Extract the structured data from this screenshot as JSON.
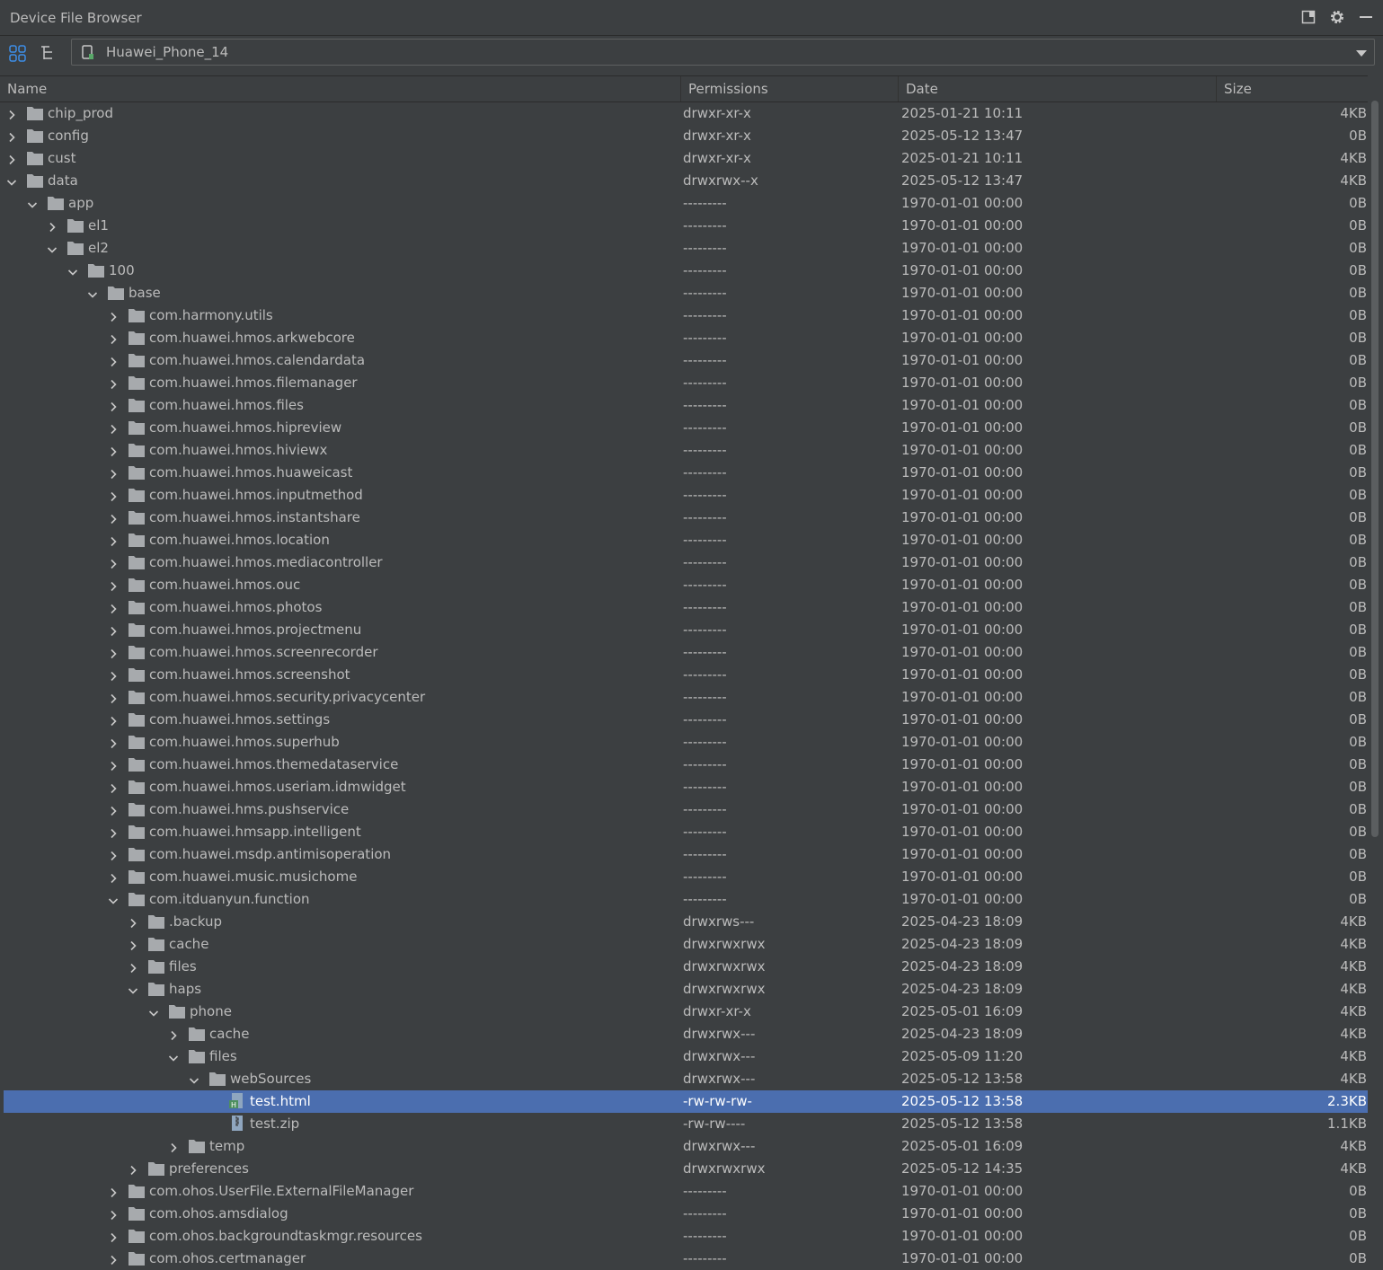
{
  "window": {
    "title": "Device File Browser"
  },
  "toolbar": {
    "device": "Huawei_Phone_14"
  },
  "columns": {
    "name": "Name",
    "permissions": "Permissions",
    "date": "Date",
    "size": "Size"
  },
  "rows": [
    {
      "name": "chip_prod",
      "perm": "drwxr-xr-x",
      "date": "2025-01-21 10:11",
      "size": "4KB",
      "depth": 0,
      "type": "folder",
      "state": "collapsed"
    },
    {
      "name": "config",
      "perm": "drwxr-xr-x",
      "date": "2025-05-12 13:47",
      "size": "0B",
      "depth": 0,
      "type": "folder",
      "state": "collapsed"
    },
    {
      "name": "cust",
      "perm": "drwxr-xr-x",
      "date": "2025-01-21 10:11",
      "size": "4KB",
      "depth": 0,
      "type": "folder",
      "state": "collapsed"
    },
    {
      "name": "data",
      "perm": "drwxrwx--x",
      "date": "2025-05-12 13:47",
      "size": "4KB",
      "depth": 0,
      "type": "folder",
      "state": "expanded"
    },
    {
      "name": "app",
      "perm": "---------",
      "date": "1970-01-01 00:00",
      "size": "0B",
      "depth": 1,
      "type": "folder",
      "state": "expanded"
    },
    {
      "name": "el1",
      "perm": "---------",
      "date": "1970-01-01 00:00",
      "size": "0B",
      "depth": 2,
      "type": "folder",
      "state": "collapsed"
    },
    {
      "name": "el2",
      "perm": "---------",
      "date": "1970-01-01 00:00",
      "size": "0B",
      "depth": 2,
      "type": "folder",
      "state": "expanded"
    },
    {
      "name": "100",
      "perm": "---------",
      "date": "1970-01-01 00:00",
      "size": "0B",
      "depth": 3,
      "type": "folder",
      "state": "expanded"
    },
    {
      "name": "base",
      "perm": "---------",
      "date": "1970-01-01 00:00",
      "size": "0B",
      "depth": 4,
      "type": "folder",
      "state": "expanded"
    },
    {
      "name": "com.harmony.utils",
      "perm": "---------",
      "date": "1970-01-01 00:00",
      "size": "0B",
      "depth": 5,
      "type": "folder",
      "state": "collapsed"
    },
    {
      "name": "com.huawei.hmos.arkwebcore",
      "perm": "---------",
      "date": "1970-01-01 00:00",
      "size": "0B",
      "depth": 5,
      "type": "folder",
      "state": "collapsed"
    },
    {
      "name": "com.huawei.hmos.calendardata",
      "perm": "---------",
      "date": "1970-01-01 00:00",
      "size": "0B",
      "depth": 5,
      "type": "folder",
      "state": "collapsed"
    },
    {
      "name": "com.huawei.hmos.filemanager",
      "perm": "---------",
      "date": "1970-01-01 00:00",
      "size": "0B",
      "depth": 5,
      "type": "folder",
      "state": "collapsed"
    },
    {
      "name": "com.huawei.hmos.files",
      "perm": "---------",
      "date": "1970-01-01 00:00",
      "size": "0B",
      "depth": 5,
      "type": "folder",
      "state": "collapsed"
    },
    {
      "name": "com.huawei.hmos.hipreview",
      "perm": "---------",
      "date": "1970-01-01 00:00",
      "size": "0B",
      "depth": 5,
      "type": "folder",
      "state": "collapsed"
    },
    {
      "name": "com.huawei.hmos.hiviewx",
      "perm": "---------",
      "date": "1970-01-01 00:00",
      "size": "0B",
      "depth": 5,
      "type": "folder",
      "state": "collapsed"
    },
    {
      "name": "com.huawei.hmos.huaweicast",
      "perm": "---------",
      "date": "1970-01-01 00:00",
      "size": "0B",
      "depth": 5,
      "type": "folder",
      "state": "collapsed"
    },
    {
      "name": "com.huawei.hmos.inputmethod",
      "perm": "---------",
      "date": "1970-01-01 00:00",
      "size": "0B",
      "depth": 5,
      "type": "folder",
      "state": "collapsed"
    },
    {
      "name": "com.huawei.hmos.instantshare",
      "perm": "---------",
      "date": "1970-01-01 00:00",
      "size": "0B",
      "depth": 5,
      "type": "folder",
      "state": "collapsed"
    },
    {
      "name": "com.huawei.hmos.location",
      "perm": "---------",
      "date": "1970-01-01 00:00",
      "size": "0B",
      "depth": 5,
      "type": "folder",
      "state": "collapsed"
    },
    {
      "name": "com.huawei.hmos.mediacontroller",
      "perm": "---------",
      "date": "1970-01-01 00:00",
      "size": "0B",
      "depth": 5,
      "type": "folder",
      "state": "collapsed"
    },
    {
      "name": "com.huawei.hmos.ouc",
      "perm": "---------",
      "date": "1970-01-01 00:00",
      "size": "0B",
      "depth": 5,
      "type": "folder",
      "state": "collapsed"
    },
    {
      "name": "com.huawei.hmos.photos",
      "perm": "---------",
      "date": "1970-01-01 00:00",
      "size": "0B",
      "depth": 5,
      "type": "folder",
      "state": "collapsed"
    },
    {
      "name": "com.huawei.hmos.projectmenu",
      "perm": "---------",
      "date": "1970-01-01 00:00",
      "size": "0B",
      "depth": 5,
      "type": "folder",
      "state": "collapsed"
    },
    {
      "name": "com.huawei.hmos.screenrecorder",
      "perm": "---------",
      "date": "1970-01-01 00:00",
      "size": "0B",
      "depth": 5,
      "type": "folder",
      "state": "collapsed"
    },
    {
      "name": "com.huawei.hmos.screenshot",
      "perm": "---------",
      "date": "1970-01-01 00:00",
      "size": "0B",
      "depth": 5,
      "type": "folder",
      "state": "collapsed"
    },
    {
      "name": "com.huawei.hmos.security.privacycenter",
      "perm": "---------",
      "date": "1970-01-01 00:00",
      "size": "0B",
      "depth": 5,
      "type": "folder",
      "state": "collapsed"
    },
    {
      "name": "com.huawei.hmos.settings",
      "perm": "---------",
      "date": "1970-01-01 00:00",
      "size": "0B",
      "depth": 5,
      "type": "folder",
      "state": "collapsed"
    },
    {
      "name": "com.huawei.hmos.superhub",
      "perm": "---------",
      "date": "1970-01-01 00:00",
      "size": "0B",
      "depth": 5,
      "type": "folder",
      "state": "collapsed"
    },
    {
      "name": "com.huawei.hmos.themedataservice",
      "perm": "---------",
      "date": "1970-01-01 00:00",
      "size": "0B",
      "depth": 5,
      "type": "folder",
      "state": "collapsed"
    },
    {
      "name": "com.huawei.hmos.useriam.idmwidget",
      "perm": "---------",
      "date": "1970-01-01 00:00",
      "size": "0B",
      "depth": 5,
      "type": "folder",
      "state": "collapsed"
    },
    {
      "name": "com.huawei.hms.pushservice",
      "perm": "---------",
      "date": "1970-01-01 00:00",
      "size": "0B",
      "depth": 5,
      "type": "folder",
      "state": "collapsed"
    },
    {
      "name": "com.huawei.hmsapp.intelligent",
      "perm": "---------",
      "date": "1970-01-01 00:00",
      "size": "0B",
      "depth": 5,
      "type": "folder",
      "state": "collapsed"
    },
    {
      "name": "com.huawei.msdp.antimisoperation",
      "perm": "---------",
      "date": "1970-01-01 00:00",
      "size": "0B",
      "depth": 5,
      "type": "folder",
      "state": "collapsed"
    },
    {
      "name": "com.huawei.music.musichome",
      "perm": "---------",
      "date": "1970-01-01 00:00",
      "size": "0B",
      "depth": 5,
      "type": "folder",
      "state": "collapsed"
    },
    {
      "name": "com.itduanyun.function",
      "perm": "---------",
      "date": "1970-01-01 00:00",
      "size": "0B",
      "depth": 5,
      "type": "folder",
      "state": "expanded"
    },
    {
      "name": ".backup",
      "perm": "drwxrws---",
      "date": "2025-04-23 18:09",
      "size": "4KB",
      "depth": 6,
      "type": "folder",
      "state": "collapsed"
    },
    {
      "name": "cache",
      "perm": "drwxrwxrwx",
      "date": "2025-04-23 18:09",
      "size": "4KB",
      "depth": 6,
      "type": "folder",
      "state": "collapsed"
    },
    {
      "name": "files",
      "perm": "drwxrwxrwx",
      "date": "2025-04-23 18:09",
      "size": "4KB",
      "depth": 6,
      "type": "folder",
      "state": "collapsed"
    },
    {
      "name": "haps",
      "perm": "drwxrwxrwx",
      "date": "2025-04-23 18:09",
      "size": "4KB",
      "depth": 6,
      "type": "folder",
      "state": "expanded"
    },
    {
      "name": "phone",
      "perm": "drwxr-xr-x",
      "date": "2025-05-01 16:09",
      "size": "4KB",
      "depth": 7,
      "type": "folder",
      "state": "expanded"
    },
    {
      "name": "cache",
      "perm": "drwxrwx---",
      "date": "2025-04-23 18:09",
      "size": "4KB",
      "depth": 8,
      "type": "folder",
      "state": "collapsed"
    },
    {
      "name": "files",
      "perm": "drwxrwx---",
      "date": "2025-05-09 11:20",
      "size": "4KB",
      "depth": 8,
      "type": "folder",
      "state": "expanded"
    },
    {
      "name": "webSources",
      "perm": "drwxrwx---",
      "date": "2025-05-12 13:58",
      "size": "4KB",
      "depth": 9,
      "type": "folder",
      "state": "expanded"
    },
    {
      "name": "test.html",
      "perm": "-rw-rw-rw-",
      "date": "2025-05-12 13:58",
      "size": "2.3KB",
      "depth": 10,
      "type": "html",
      "state": "none",
      "selected": true
    },
    {
      "name": "test.zip",
      "perm": "-rw-rw----",
      "date": "2025-05-12 13:58",
      "size": "1.1KB",
      "depth": 10,
      "type": "zip",
      "state": "none"
    },
    {
      "name": "temp",
      "perm": "drwxrwx---",
      "date": "2025-05-01 16:09",
      "size": "4KB",
      "depth": 8,
      "type": "folder",
      "state": "collapsed"
    },
    {
      "name": "preferences",
      "perm": "drwxrwxrwx",
      "date": "2025-05-12 14:35",
      "size": "4KB",
      "depth": 6,
      "type": "folder",
      "state": "collapsed"
    },
    {
      "name": "com.ohos.UserFile.ExternalFileManager",
      "perm": "---------",
      "date": "1970-01-01 00:00",
      "size": "0B",
      "depth": 5,
      "type": "folder",
      "state": "collapsed"
    },
    {
      "name": "com.ohos.amsdialog",
      "perm": "---------",
      "date": "1970-01-01 00:00",
      "size": "0B",
      "depth": 5,
      "type": "folder",
      "state": "collapsed"
    },
    {
      "name": "com.ohos.backgroundtaskmgr.resources",
      "perm": "---------",
      "date": "1970-01-01 00:00",
      "size": "0B",
      "depth": 5,
      "type": "folder",
      "state": "collapsed"
    },
    {
      "name": "com.ohos.certmanager",
      "perm": "---------",
      "date": "1970-01-01 00:00",
      "size": "0B",
      "depth": 5,
      "type": "folder",
      "state": "collapsed"
    }
  ]
}
